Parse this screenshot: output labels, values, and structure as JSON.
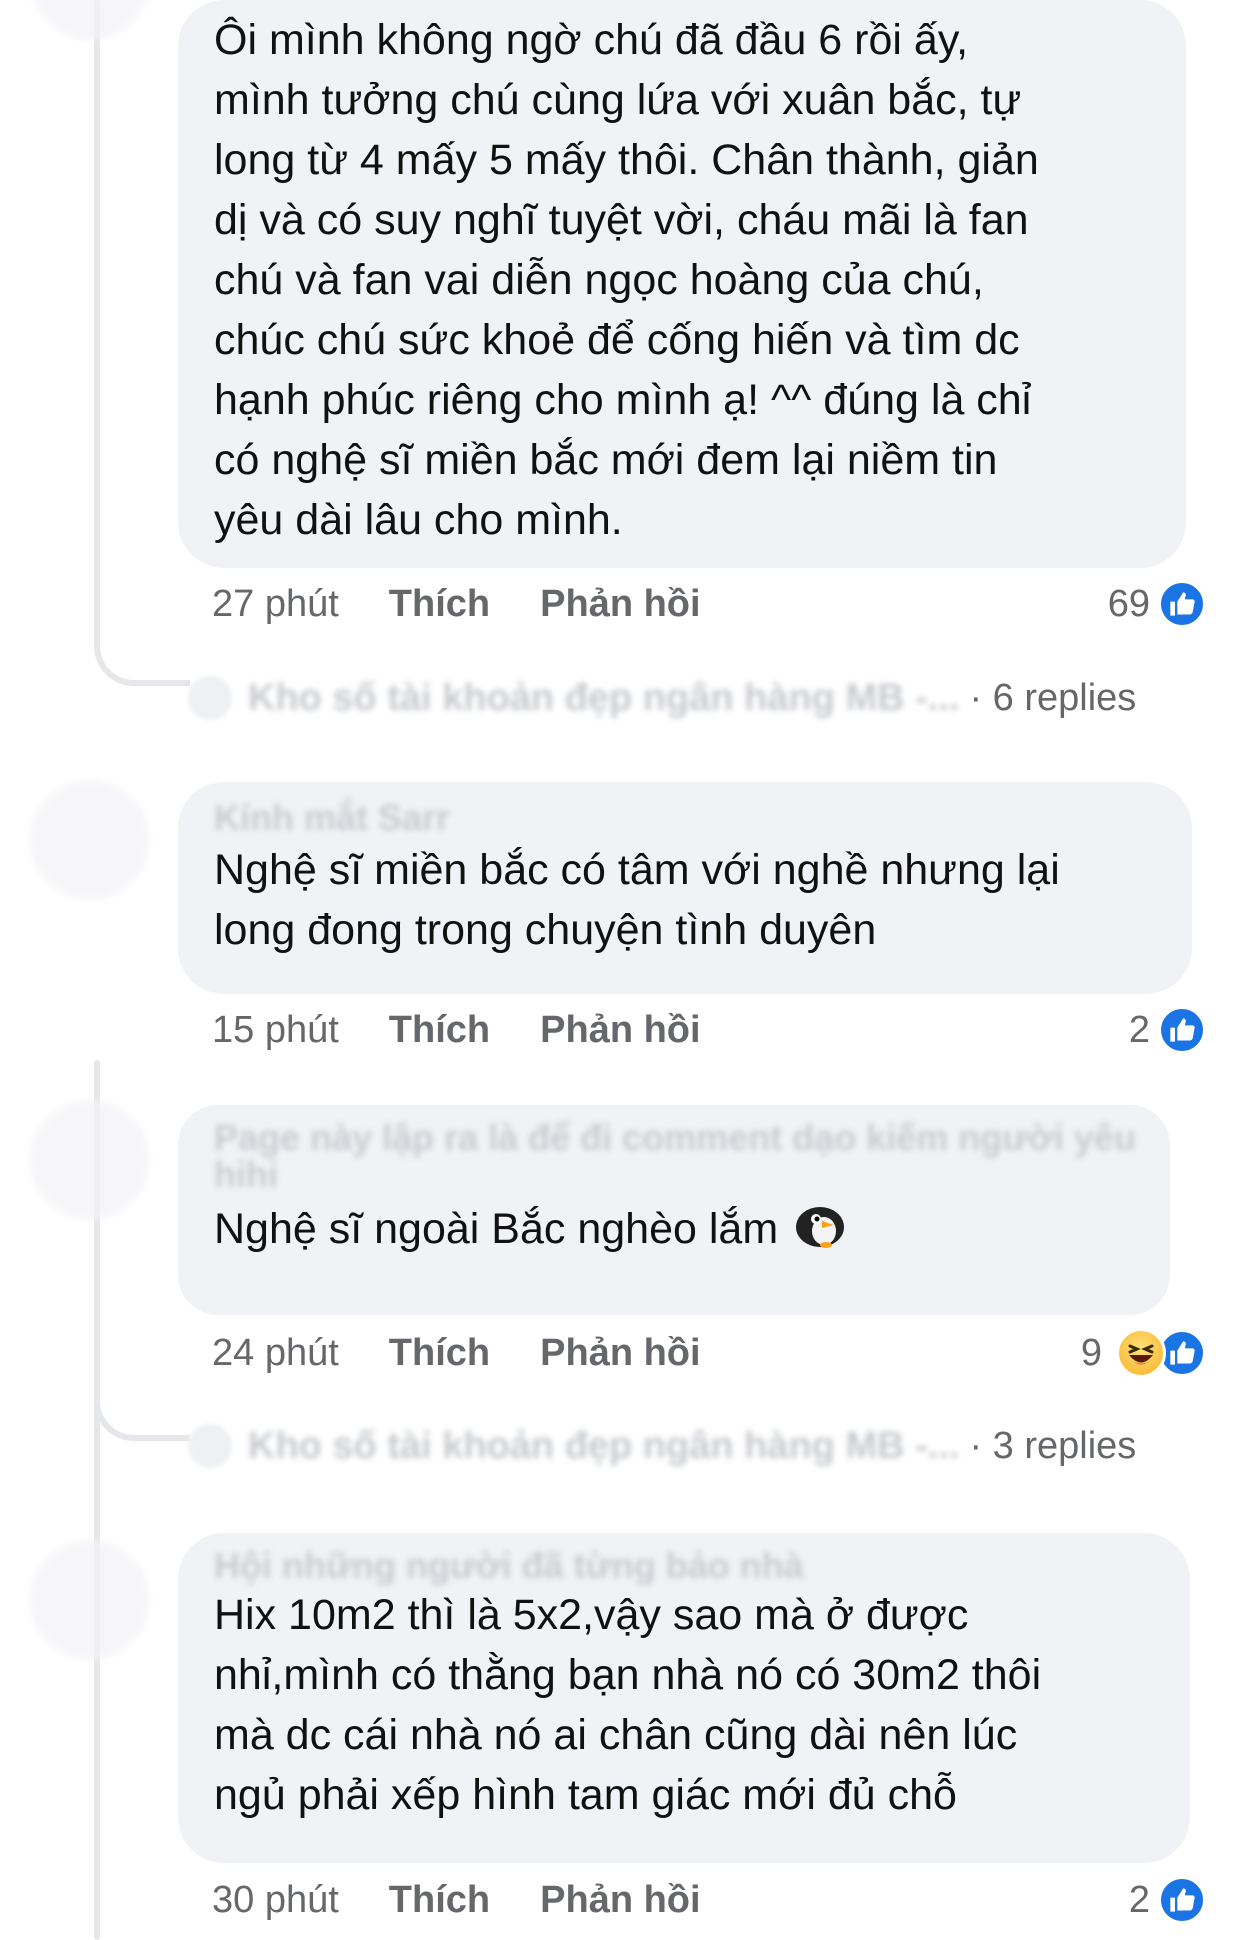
{
  "comments": [
    {
      "author": "",
      "text": "Ôi mình không ngờ chú đã đầu 6 rồi ấy,\nmình tưởng chú cùng lứa với xuân bắc, tự\nlong từ 4 mấy 5 mấy thôi. Chân thành, giản\ndị và có suy nghĩ tuyệt vời, cháu mãi là fan\nchú và fan vai diễn ngọc hoàng của chú,\nchúc chú sức khoẻ để cống hiến và tìm dc\nhạnh phúc riêng cho mình ạ! ^^ đúng là chỉ\ncó nghệ sĩ miền bắc mới đem lại niềm tin\nyêu dài lâu cho mình.",
      "time": "27 phút",
      "like": "Thích",
      "reply": "Phản hồi",
      "reaction_count": "69",
      "reactions": [
        "like-icon"
      ],
      "replies": {
        "author": "Kho số tài khoản đẹp ngân hàng MB -...",
        "count": "· 6 replies"
      }
    },
    {
      "author": "Kính mắt Sarr",
      "text": "Nghệ sĩ miền bắc có tâm với nghề nhưng lại\nlong đong trong chuyện tình duyên",
      "time": "15 phút",
      "like": "Thích",
      "reply": "Phản hồi",
      "reaction_count": "2",
      "reactions": [
        "like-icon"
      ]
    },
    {
      "author": "Page này lập ra là để đi comment dạo kiếm người yêu hihi",
      "text": "Nghệ sĩ ngoài Bắc nghèo lắm",
      "emoji": "penguin-icon",
      "time": "24 phút",
      "like": "Thích",
      "reply": "Phản hồi",
      "reaction_count": "9",
      "reactions": [
        "haha-icon",
        "like-icon"
      ],
      "replies": {
        "author": "Kho số tài khoản đẹp ngân hàng MB -...",
        "count": "· 3 replies"
      }
    },
    {
      "author": "Hội những người đã từng bảo nhà",
      "text": "Hix 10m2 thì là 5x2,vậy sao mà ở được\nnhỉ,mình có thằng bạn nhà nó có 30m2 thôi\nmà dc cái nhà nó ai chân cũng dài nên lúc\nngủ phải xếp hình tam giác mới đủ chỗ",
      "time": "30 phút",
      "like": "Thích",
      "reply": "Phản hồi",
      "reaction_count": "2",
      "reactions": [
        "like-icon"
      ]
    }
  ],
  "colors": {
    "bubble": "#f0f2f5",
    "like": "#1b74e4",
    "meta": "#65676b"
  }
}
